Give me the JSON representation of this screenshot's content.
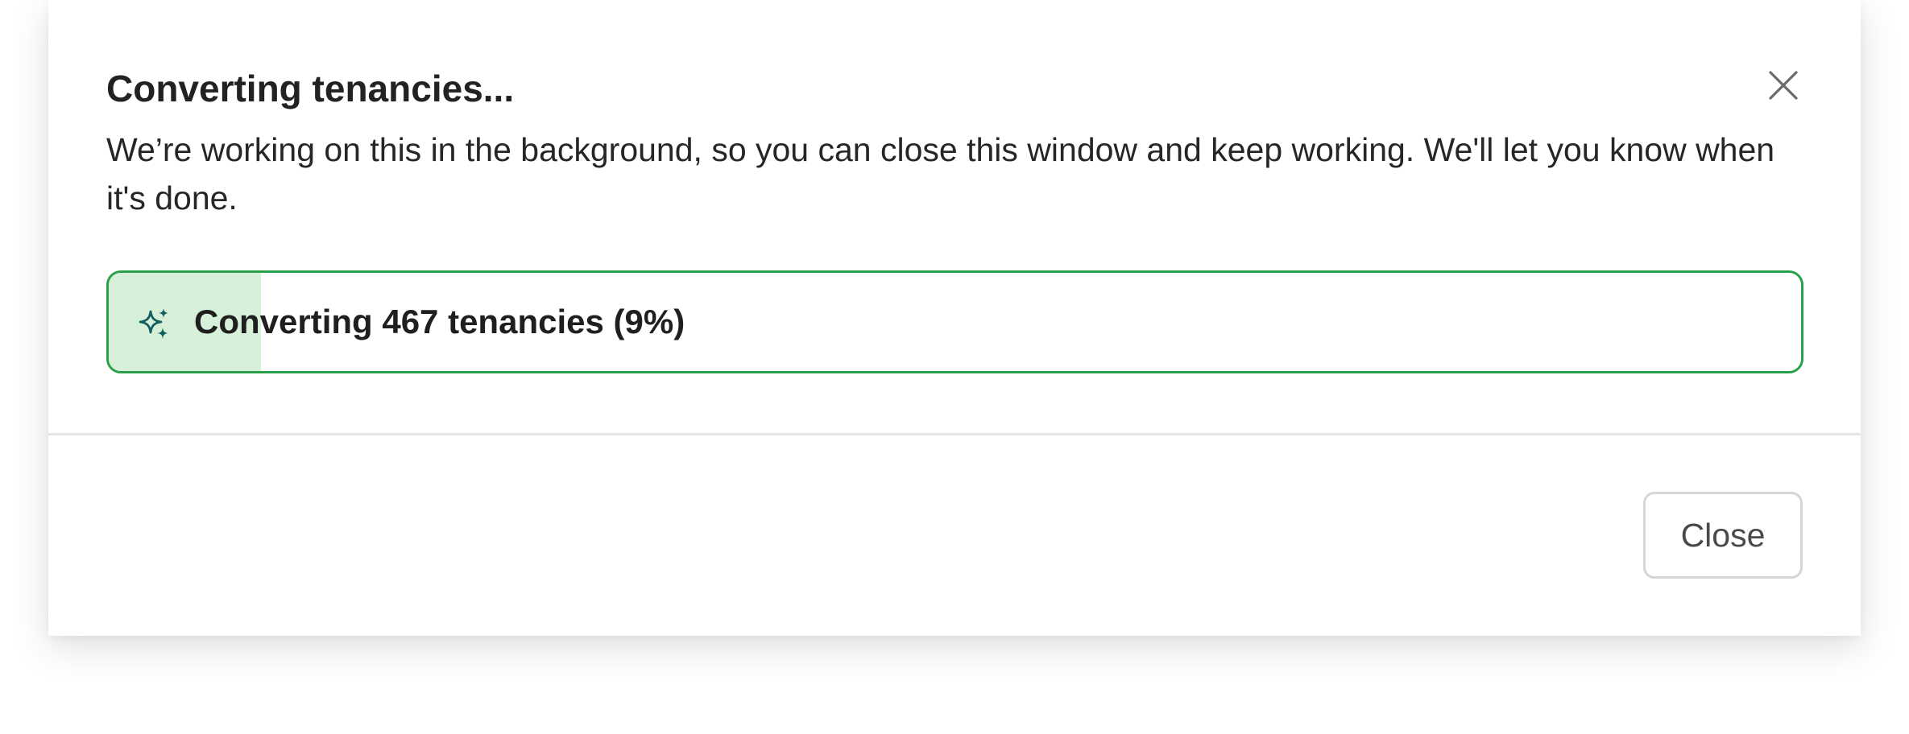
{
  "dialog": {
    "title": "Converting tenancies...",
    "description": "We’re working on this in the background, so you can close this window and keep working. We'll let you know when it's done.",
    "close_icon": "close-icon"
  },
  "progress": {
    "label": "Converting 467 tenancies (9%)",
    "percent": 9,
    "icon": "sparkles-icon",
    "colors": {
      "border": "#2aa148",
      "fill": "#d6f0da",
      "icon": "#135e5e"
    }
  },
  "footer": {
    "close_label": "Close"
  }
}
